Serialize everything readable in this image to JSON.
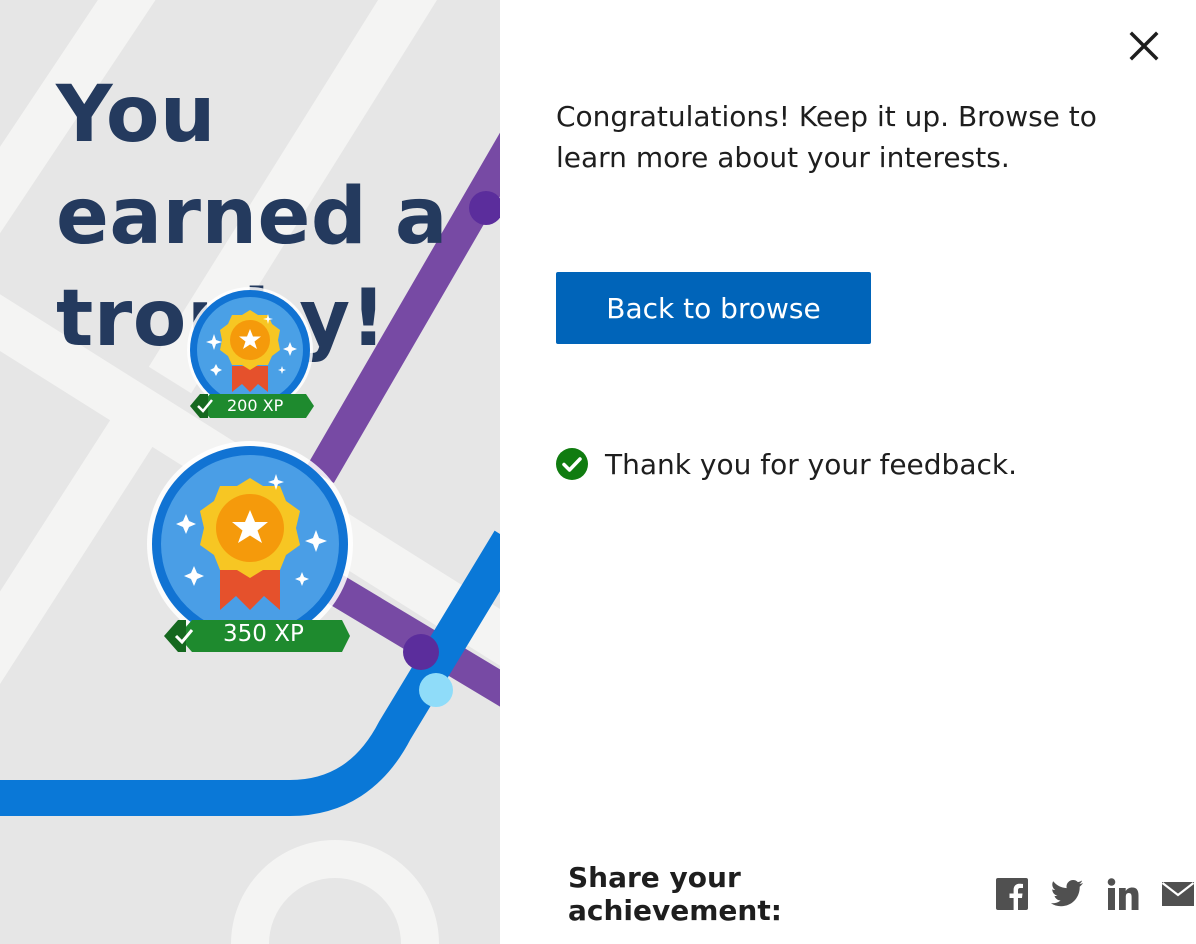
{
  "dialog": {
    "headline": "You earned a trophy!",
    "message": "Congratulations! Keep it up. Browse to learn more about your interests.",
    "back_button_label": "Back to browse",
    "close_icon": "close-icon",
    "feedback_text": "Thank you for your feedback.",
    "feedback_icon": "check-circle-icon"
  },
  "badges": [
    {
      "xp_label": "200 XP",
      "icon": "medal-icon"
    },
    {
      "xp_label": "350 XP",
      "icon": "trophy-medal-icon"
    }
  ],
  "share": {
    "label": "Share your achievement:",
    "networks": [
      "facebook-icon",
      "twitter-icon",
      "linkedin-icon",
      "email-icon"
    ]
  },
  "colors": {
    "headline": "#243a5e",
    "primary_button": "#0064b9",
    "success": "#107c10",
    "map_background": "#e6e6e6",
    "map_line_purple": "#7a4aa6",
    "map_line_blue": "#0078d4",
    "badge_banner": "#1e8a2e"
  }
}
